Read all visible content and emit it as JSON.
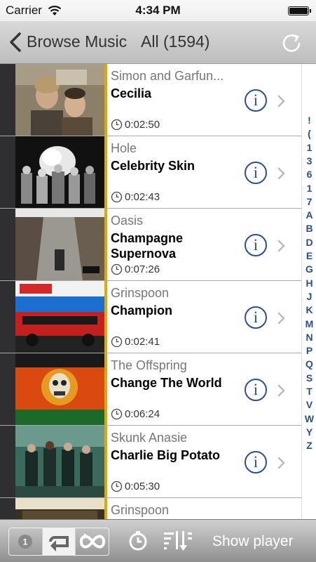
{
  "status": {
    "carrier": "Carrier",
    "time": "4:34 PM"
  },
  "nav": {
    "back_label": "Browse Music",
    "title": "All (1594)"
  },
  "tracks": [
    {
      "artist": "Simon and Garfun...",
      "song": "Cecilia",
      "duration": "0:02:50"
    },
    {
      "artist": "Hole",
      "song": "Celebrity Skin",
      "duration": "0:02:43"
    },
    {
      "artist": "Oasis",
      "song": "Champagne Supernova",
      "duration": "0:07:26"
    },
    {
      "artist": "Grinspoon",
      "song": "Champion",
      "duration": "0:02:41"
    },
    {
      "artist": "The Offspring",
      "song": "Change The World",
      "duration": "0:06:24"
    },
    {
      "artist": "Skunk Anasie",
      "song": "Charlie Big Potato",
      "duration": "0:05:30"
    },
    {
      "artist": "Grinspoon",
      "song": "",
      "duration": ""
    }
  ],
  "index": [
    "!",
    "(",
    "1",
    "3",
    "6",
    "1",
    "7",
    "A",
    "B",
    "D",
    "E",
    "G",
    "H",
    "J",
    "K",
    "M",
    "N",
    "P",
    "Q",
    "S",
    "T",
    "V",
    "W",
    "Y",
    "Z"
  ],
  "toolbar": {
    "repeat_one_label": "1",
    "show_player": "Show player"
  },
  "colors": {
    "accent": "#e0a800",
    "info_blue": "#2d4f86"
  }
}
